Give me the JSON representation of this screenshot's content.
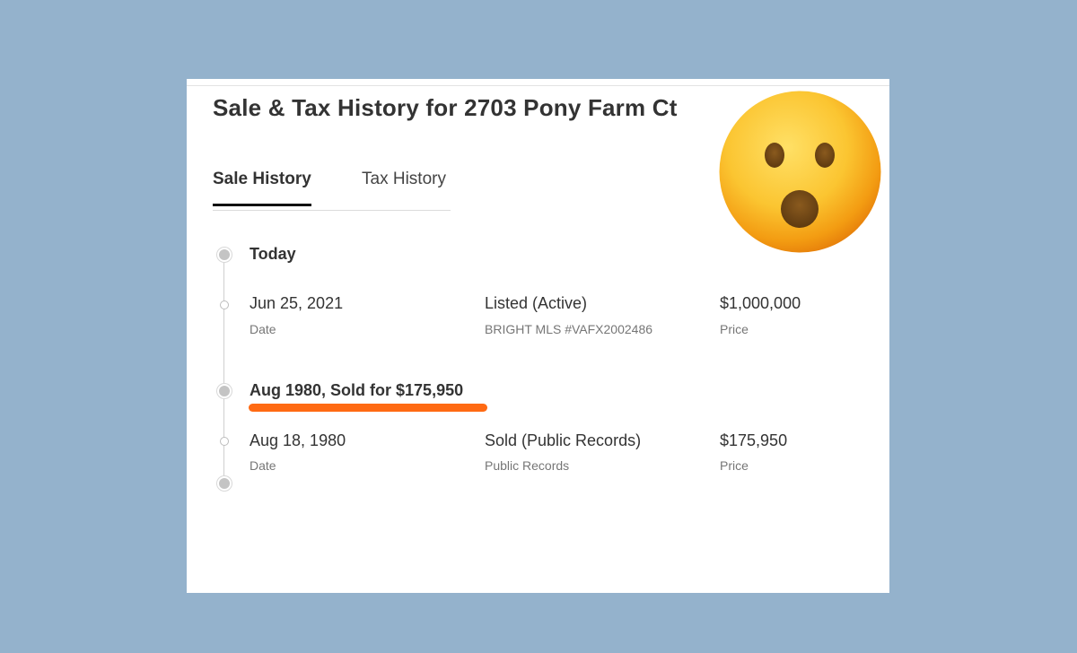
{
  "heading": "Sale & Tax History for 2703 Pony Farm Ct",
  "tabs": {
    "sale_history": "Sale History",
    "tax_history": "Tax History"
  },
  "timeline": {
    "today_label": "Today",
    "entry_1": {
      "date": "Jun 25, 2021",
      "date_label": "Date",
      "event": "Listed (Active)",
      "source": "BRIGHT MLS #VAFX2002486",
      "price": "$1,000,000",
      "price_label": "Price"
    },
    "group_2_label": "Aug 1980, Sold for $175,950",
    "entry_2": {
      "date": "Aug 18, 1980",
      "date_label": "Date",
      "event": "Sold (Public Records)",
      "source": "Public Records",
      "price": "$175,950",
      "price_label": "Price"
    }
  },
  "colors": {
    "background": "#94b2cc",
    "highlight": "#ff6a13",
    "emoji_face": "#f7b82b"
  },
  "emoji": "astonished-face-icon"
}
